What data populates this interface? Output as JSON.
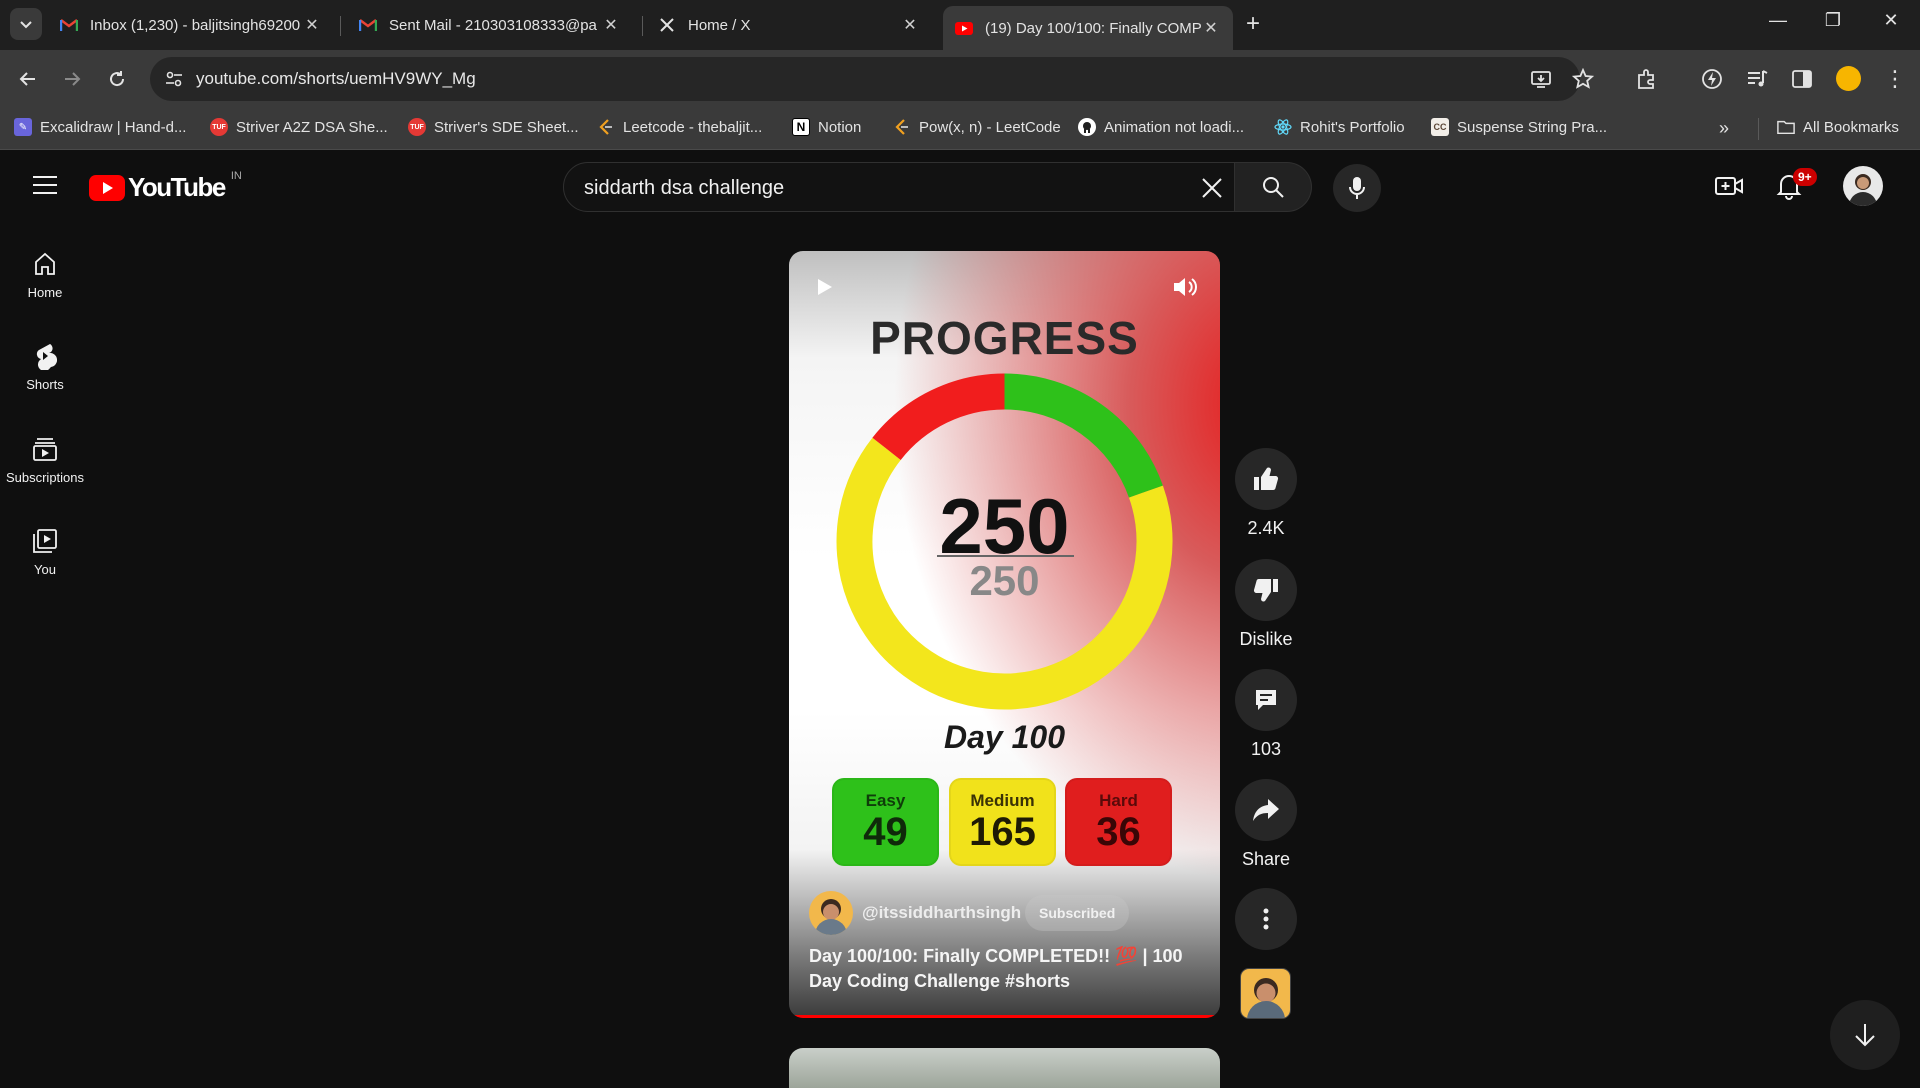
{
  "browser": {
    "tabs": [
      {
        "title": "Inbox (1,230) - baljitsingh69200",
        "icon": "gmail-icon",
        "active": false
      },
      {
        "title": "Sent Mail - 210303108333@pa",
        "icon": "gmail-icon",
        "active": false
      },
      {
        "title": "Home / X",
        "icon": "x-icon",
        "active": false
      },
      {
        "title": "(19) Day 100/100: Finally COMP",
        "icon": "youtube-icon",
        "active": true
      }
    ],
    "close_glyph": "✕",
    "new_tab_glyph": "+",
    "window_controls": {
      "minimize": "—",
      "restore": "❐",
      "close": "✕"
    },
    "url": "youtube.com/shorts/uemHV9WY_Mg",
    "bookmarks": [
      {
        "label": "Excalidraw | Hand-d...",
        "icon": "excalidraw-icon"
      },
      {
        "label": "Striver A2Z DSA She...",
        "icon": "tuf-icon"
      },
      {
        "label": "Striver's SDE Sheet...",
        "icon": "tuf-icon"
      },
      {
        "label": "Leetcode -  thebaljit...",
        "icon": "leetcode-icon"
      },
      {
        "label": "Notion",
        "icon": "notion-icon"
      },
      {
        "label": "Pow(x, n) - LeetCode",
        "icon": "leetcode-icon"
      },
      {
        "label": "Animation not loadi...",
        "icon": "github-icon"
      },
      {
        "label": "Rohit's Portfolio",
        "icon": "react-icon"
      },
      {
        "label": "Suspense String Pra...",
        "icon": "codechef-icon"
      }
    ],
    "bookmarks_overflow": "»",
    "all_bookmarks": "All Bookmarks"
  },
  "youtube": {
    "logo_text": "YouTube",
    "country_code": "IN",
    "search_query": "siddarth  dsa challenge",
    "notification_count": "9+",
    "guide": [
      {
        "label": "Home",
        "icon": "home-icon"
      },
      {
        "label": "Shorts",
        "icon": "shorts-icon"
      },
      {
        "label": "Subscriptions",
        "icon": "subscriptions-icon"
      },
      {
        "label": "You",
        "icon": "you-icon"
      }
    ],
    "short": {
      "heading": "PROGRESS",
      "solved": "250",
      "total": "250",
      "day_label": "Day 100",
      "difficulty": [
        {
          "label": "Easy",
          "value": "49",
          "color": "#2ec11a"
        },
        {
          "label": "Medium",
          "value": "165",
          "color": "#f1e21b"
        },
        {
          "label": "Hard",
          "value": "36",
          "color": "#e01e1e"
        }
      ],
      "ring": {
        "segments": [
          {
            "name": "easy",
            "value": 49,
            "color": "#2ec11a"
          },
          {
            "name": "medium",
            "value": 165,
            "color": "#f3e61c"
          },
          {
            "name": "hard",
            "value": 36,
            "color": "#f11d1d"
          }
        ]
      },
      "channel": "@itssiddharthsingh",
      "subscribe_state": "Subscribed",
      "caption": "Day 100/100: Finally COMPLETED!! 💯 | 100 Day Coding Challenge #shorts"
    },
    "actions": {
      "likes": "2.4K",
      "dislike": "Dislike",
      "comments": "103",
      "share": "Share"
    },
    "accent": "#ff0000"
  }
}
